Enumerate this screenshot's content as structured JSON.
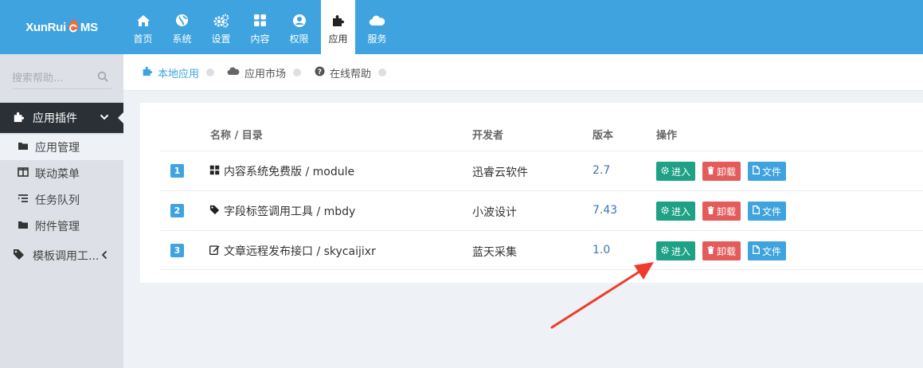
{
  "app": {
    "logo_text_left": "XunRui",
    "logo_text_right": "MS"
  },
  "nav": {
    "items": [
      {
        "label": "首页",
        "icon": "home-icon"
      },
      {
        "label": "系统",
        "icon": "globe-icon"
      },
      {
        "label": "设置",
        "icon": "gears-icon"
      },
      {
        "label": "内容",
        "icon": "grid-icon"
      },
      {
        "label": "权限",
        "icon": "user-circle-icon"
      },
      {
        "label": "应用",
        "icon": "puzzle-icon",
        "active": true
      },
      {
        "label": "服务",
        "icon": "cloud-icon"
      }
    ]
  },
  "sidebar": {
    "search_placeholder": "搜索帮助...",
    "group_label": "应用插件",
    "items": [
      {
        "label": "应用管理",
        "icon": "folder-icon",
        "active": true
      },
      {
        "label": "联动菜单",
        "icon": "columns-icon"
      },
      {
        "label": "任务队列",
        "icon": "list-icon"
      },
      {
        "label": "附件管理",
        "icon": "folder-icon"
      }
    ],
    "template_item": "模板调用工..."
  },
  "tabs": [
    {
      "label": "本地应用",
      "icon": "puzzle-icon",
      "active": true
    },
    {
      "label": "应用市场",
      "icon": "cloud-icon"
    },
    {
      "label": "在线帮助",
      "icon": "question-circle-icon"
    }
  ],
  "table": {
    "headers": {
      "name": "名称 / 目录",
      "developer": "开发者",
      "version": "版本",
      "actions": "操作"
    },
    "rows": [
      {
        "num": "1",
        "icon": "grid-icon",
        "name": "内容系统免费版 / module",
        "developer": "迅睿云软件",
        "version": "2.7"
      },
      {
        "num": "2",
        "icon": "tag-icon",
        "name": "字段标签调用工具 / mbdy",
        "developer": "小波设计",
        "version": "7.43"
      },
      {
        "num": "3",
        "icon": "edit-icon",
        "name": "文章远程发布接口 / skycaijixr",
        "developer": "蓝天采集",
        "version": "1.0"
      }
    ],
    "buttons": {
      "enter": "进入",
      "uninstall": "卸载",
      "file": "文件"
    }
  },
  "colors": {
    "header": "#3ea3de",
    "sidebar": "#dde0e6",
    "sidebar_active": "#2b3036",
    "enter": "#1ea185",
    "uninstall": "#e35b5a",
    "file": "#3ea3de",
    "annotation_arrow": "#ef3b2d"
  }
}
